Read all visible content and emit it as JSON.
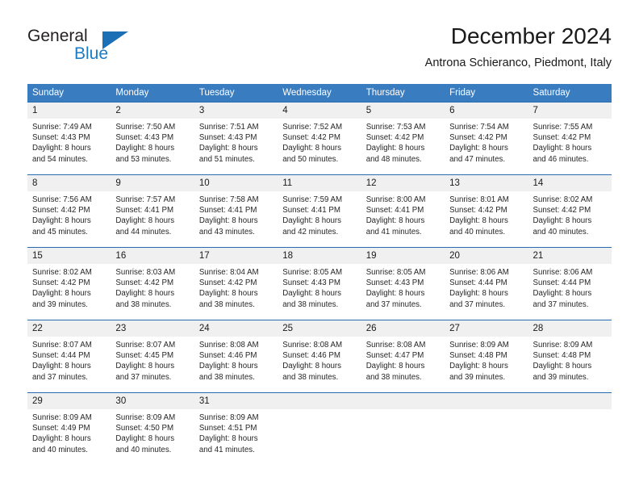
{
  "brand": {
    "name_part1": "General",
    "name_part2": "Blue",
    "triangle_icon": "triangle-icon",
    "colors": {
      "general_text": "#231f20",
      "blue_text": "#1b7bc4",
      "triangle": "#1b6fb5"
    }
  },
  "header": {
    "title": "December 2024",
    "subtitle": "Antrona Schieranco, Piedmont, Italy"
  },
  "calendar": {
    "header_bg": "#3a7cc0",
    "daynum_bg": "#f0f0f0",
    "row_border": "#2a6cb0",
    "weekday_headers": [
      "Sunday",
      "Monday",
      "Tuesday",
      "Wednesday",
      "Thursday",
      "Friday",
      "Saturday"
    ],
    "weeks": [
      [
        {
          "day": "1",
          "sunrise": "Sunrise: 7:49 AM",
          "sunset": "Sunset: 4:43 PM",
          "daylight1": "Daylight: 8 hours",
          "daylight2": "and 54 minutes."
        },
        {
          "day": "2",
          "sunrise": "Sunrise: 7:50 AM",
          "sunset": "Sunset: 4:43 PM",
          "daylight1": "Daylight: 8 hours",
          "daylight2": "and 53 minutes."
        },
        {
          "day": "3",
          "sunrise": "Sunrise: 7:51 AM",
          "sunset": "Sunset: 4:43 PM",
          "daylight1": "Daylight: 8 hours",
          "daylight2": "and 51 minutes."
        },
        {
          "day": "4",
          "sunrise": "Sunrise: 7:52 AM",
          "sunset": "Sunset: 4:42 PM",
          "daylight1": "Daylight: 8 hours",
          "daylight2": "and 50 minutes."
        },
        {
          "day": "5",
          "sunrise": "Sunrise: 7:53 AM",
          "sunset": "Sunset: 4:42 PM",
          "daylight1": "Daylight: 8 hours",
          "daylight2": "and 48 minutes."
        },
        {
          "day": "6",
          "sunrise": "Sunrise: 7:54 AM",
          "sunset": "Sunset: 4:42 PM",
          "daylight1": "Daylight: 8 hours",
          "daylight2": "and 47 minutes."
        },
        {
          "day": "7",
          "sunrise": "Sunrise: 7:55 AM",
          "sunset": "Sunset: 4:42 PM",
          "daylight1": "Daylight: 8 hours",
          "daylight2": "and 46 minutes."
        }
      ],
      [
        {
          "day": "8",
          "sunrise": "Sunrise: 7:56 AM",
          "sunset": "Sunset: 4:42 PM",
          "daylight1": "Daylight: 8 hours",
          "daylight2": "and 45 minutes."
        },
        {
          "day": "9",
          "sunrise": "Sunrise: 7:57 AM",
          "sunset": "Sunset: 4:41 PM",
          "daylight1": "Daylight: 8 hours",
          "daylight2": "and 44 minutes."
        },
        {
          "day": "10",
          "sunrise": "Sunrise: 7:58 AM",
          "sunset": "Sunset: 4:41 PM",
          "daylight1": "Daylight: 8 hours",
          "daylight2": "and 43 minutes."
        },
        {
          "day": "11",
          "sunrise": "Sunrise: 7:59 AM",
          "sunset": "Sunset: 4:41 PM",
          "daylight1": "Daylight: 8 hours",
          "daylight2": "and 42 minutes."
        },
        {
          "day": "12",
          "sunrise": "Sunrise: 8:00 AM",
          "sunset": "Sunset: 4:41 PM",
          "daylight1": "Daylight: 8 hours",
          "daylight2": "and 41 minutes."
        },
        {
          "day": "13",
          "sunrise": "Sunrise: 8:01 AM",
          "sunset": "Sunset: 4:42 PM",
          "daylight1": "Daylight: 8 hours",
          "daylight2": "and 40 minutes."
        },
        {
          "day": "14",
          "sunrise": "Sunrise: 8:02 AM",
          "sunset": "Sunset: 4:42 PM",
          "daylight1": "Daylight: 8 hours",
          "daylight2": "and 40 minutes."
        }
      ],
      [
        {
          "day": "15",
          "sunrise": "Sunrise: 8:02 AM",
          "sunset": "Sunset: 4:42 PM",
          "daylight1": "Daylight: 8 hours",
          "daylight2": "and 39 minutes."
        },
        {
          "day": "16",
          "sunrise": "Sunrise: 8:03 AM",
          "sunset": "Sunset: 4:42 PM",
          "daylight1": "Daylight: 8 hours",
          "daylight2": "and 38 minutes."
        },
        {
          "day": "17",
          "sunrise": "Sunrise: 8:04 AM",
          "sunset": "Sunset: 4:42 PM",
          "daylight1": "Daylight: 8 hours",
          "daylight2": "and 38 minutes."
        },
        {
          "day": "18",
          "sunrise": "Sunrise: 8:05 AM",
          "sunset": "Sunset: 4:43 PM",
          "daylight1": "Daylight: 8 hours",
          "daylight2": "and 38 minutes."
        },
        {
          "day": "19",
          "sunrise": "Sunrise: 8:05 AM",
          "sunset": "Sunset: 4:43 PM",
          "daylight1": "Daylight: 8 hours",
          "daylight2": "and 37 minutes."
        },
        {
          "day": "20",
          "sunrise": "Sunrise: 8:06 AM",
          "sunset": "Sunset: 4:44 PM",
          "daylight1": "Daylight: 8 hours",
          "daylight2": "and 37 minutes."
        },
        {
          "day": "21",
          "sunrise": "Sunrise: 8:06 AM",
          "sunset": "Sunset: 4:44 PM",
          "daylight1": "Daylight: 8 hours",
          "daylight2": "and 37 minutes."
        }
      ],
      [
        {
          "day": "22",
          "sunrise": "Sunrise: 8:07 AM",
          "sunset": "Sunset: 4:44 PM",
          "daylight1": "Daylight: 8 hours",
          "daylight2": "and 37 minutes."
        },
        {
          "day": "23",
          "sunrise": "Sunrise: 8:07 AM",
          "sunset": "Sunset: 4:45 PM",
          "daylight1": "Daylight: 8 hours",
          "daylight2": "and 37 minutes."
        },
        {
          "day": "24",
          "sunrise": "Sunrise: 8:08 AM",
          "sunset": "Sunset: 4:46 PM",
          "daylight1": "Daylight: 8 hours",
          "daylight2": "and 38 minutes."
        },
        {
          "day": "25",
          "sunrise": "Sunrise: 8:08 AM",
          "sunset": "Sunset: 4:46 PM",
          "daylight1": "Daylight: 8 hours",
          "daylight2": "and 38 minutes."
        },
        {
          "day": "26",
          "sunrise": "Sunrise: 8:08 AM",
          "sunset": "Sunset: 4:47 PM",
          "daylight1": "Daylight: 8 hours",
          "daylight2": "and 38 minutes."
        },
        {
          "day": "27",
          "sunrise": "Sunrise: 8:09 AM",
          "sunset": "Sunset: 4:48 PM",
          "daylight1": "Daylight: 8 hours",
          "daylight2": "and 39 minutes."
        },
        {
          "day": "28",
          "sunrise": "Sunrise: 8:09 AM",
          "sunset": "Sunset: 4:48 PM",
          "daylight1": "Daylight: 8 hours",
          "daylight2": "and 39 minutes."
        }
      ],
      [
        {
          "day": "29",
          "sunrise": "Sunrise: 8:09 AM",
          "sunset": "Sunset: 4:49 PM",
          "daylight1": "Daylight: 8 hours",
          "daylight2": "and 40 minutes."
        },
        {
          "day": "30",
          "sunrise": "Sunrise: 8:09 AM",
          "sunset": "Sunset: 4:50 PM",
          "daylight1": "Daylight: 8 hours",
          "daylight2": "and 40 minutes."
        },
        {
          "day": "31",
          "sunrise": "Sunrise: 8:09 AM",
          "sunset": "Sunset: 4:51 PM",
          "daylight1": "Daylight: 8 hours",
          "daylight2": "and 41 minutes."
        },
        {
          "day": "",
          "sunrise": "",
          "sunset": "",
          "daylight1": "",
          "daylight2": ""
        },
        {
          "day": "",
          "sunrise": "",
          "sunset": "",
          "daylight1": "",
          "daylight2": ""
        },
        {
          "day": "",
          "sunrise": "",
          "sunset": "",
          "daylight1": "",
          "daylight2": ""
        },
        {
          "day": "",
          "sunrise": "",
          "sunset": "",
          "daylight1": "",
          "daylight2": ""
        }
      ]
    ]
  }
}
